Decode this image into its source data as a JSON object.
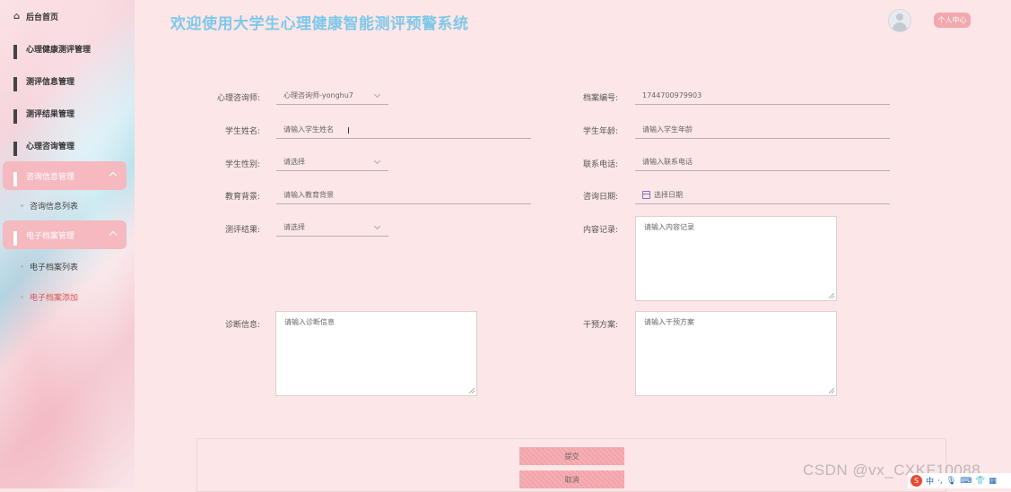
{
  "header": {
    "title": "欢迎使用大学生心理健康智能测评预警系统",
    "user_center": "个人中心"
  },
  "sidebar": {
    "items": [
      {
        "label": "后台首页",
        "icon": "home-icon"
      },
      {
        "label": "心理健康测评管理",
        "icon": "grid-icon"
      },
      {
        "label": "测评信息管理",
        "icon": "grid-icon"
      },
      {
        "label": "测评结果管理",
        "icon": "grid-icon"
      },
      {
        "label": "心理咨询管理",
        "icon": "grid-icon"
      },
      {
        "label": "咨询信息管理",
        "icon": "grid-icon",
        "expanded": true,
        "children": [
          {
            "label": "咨询信息列表"
          }
        ]
      },
      {
        "label": "电子档案管理",
        "icon": "grid-icon",
        "expanded": true,
        "children": [
          {
            "label": "电子档案列表"
          },
          {
            "label": "电子档案添加",
            "current": true
          }
        ]
      }
    ]
  },
  "form": {
    "counselor": {
      "label": "心理咨询师:",
      "value": "心理咨询师-yonghu7"
    },
    "archive_no": {
      "label": "档案编号:",
      "value": "1744700979903"
    },
    "student_name": {
      "label": "学生姓名:",
      "placeholder": "请输入学生姓名"
    },
    "student_age": {
      "label": "学生年龄:",
      "placeholder": "请输入学生年龄"
    },
    "student_gender": {
      "label": "学生性别:",
      "placeholder": "请选择"
    },
    "phone": {
      "label": "联系电话:",
      "placeholder": "请输入联系电话"
    },
    "education": {
      "label": "教育背景:",
      "placeholder": "请输入教育背景"
    },
    "consult_date": {
      "label": "咨询日期:",
      "placeholder": "选择日期"
    },
    "eval_result": {
      "label": "测评结果:",
      "placeholder": "请选择"
    },
    "content_record": {
      "label": "内容记录:",
      "placeholder": "请输入内容记录"
    },
    "diagnosis": {
      "label": "诊断信息:",
      "placeholder": "请输入诊断信息"
    },
    "intervention": {
      "label": "干预方案:",
      "placeholder": "请输入干预方案"
    },
    "submit_label": "提交",
    "cancel_label": "取消"
  },
  "colors": {
    "background": "#fde6e7",
    "title": "#7ec8e9",
    "accent": "#f3a8ae",
    "current_link": "#d9534f"
  },
  "watermark": "CSDN @vx_CXKF10088",
  "tray": {
    "ime": "中"
  }
}
